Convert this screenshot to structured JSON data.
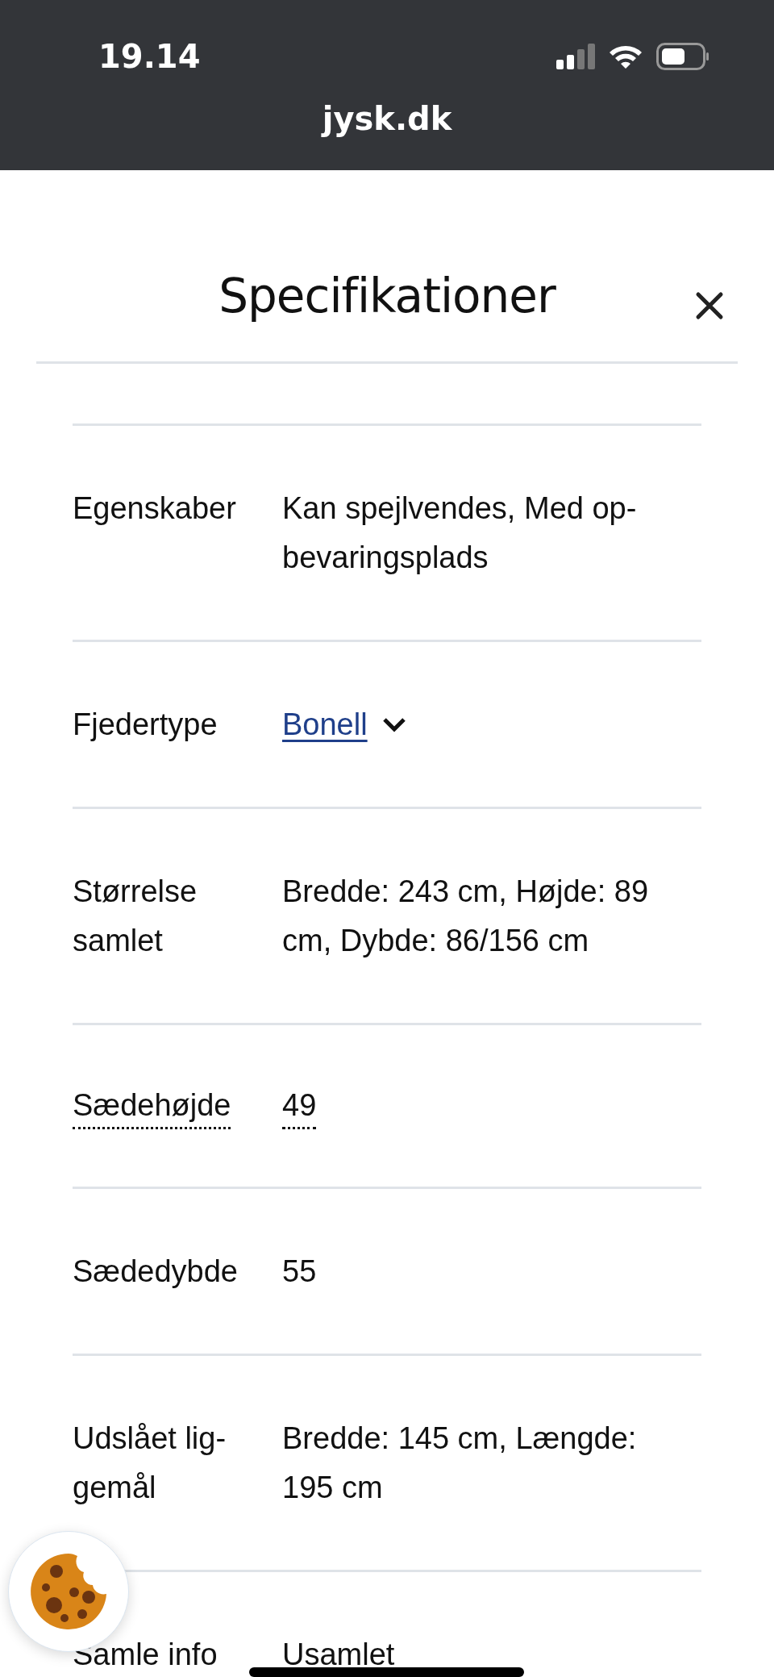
{
  "status_bar": {
    "time": "19.14"
  },
  "browser": {
    "url": "jysk.dk"
  },
  "dialog": {
    "title": "Specifikationer",
    "rows": [
      {
        "label": "Egenskaber",
        "value": "Kan spejlvendes, Med op-\nbevaringsplads",
        "kind": "text",
        "dotted": false
      },
      {
        "label": "Fjedertype",
        "value": "Bonell",
        "kind": "link",
        "dotted": false
      },
      {
        "label": "Størrelse\nsamlet",
        "value": "Bredde: 243 cm, Højde: 89\ncm, Dybde: 86/156 cm",
        "kind": "text",
        "dotted": false
      },
      {
        "label": "Sædehøjde",
        "value": "49",
        "kind": "text",
        "dotted": true
      },
      {
        "label": "Sædedybde",
        "value": "55",
        "kind": "text",
        "dotted": false
      },
      {
        "label": "Udslået lig-\ngemål",
        "value": "Bredde: 145 cm, Længde:\n195 cm",
        "kind": "text",
        "dotted": false
      },
      {
        "label": "Samle info",
        "value": "Usamlet",
        "kind": "text",
        "dotted": false
      }
    ]
  }
}
